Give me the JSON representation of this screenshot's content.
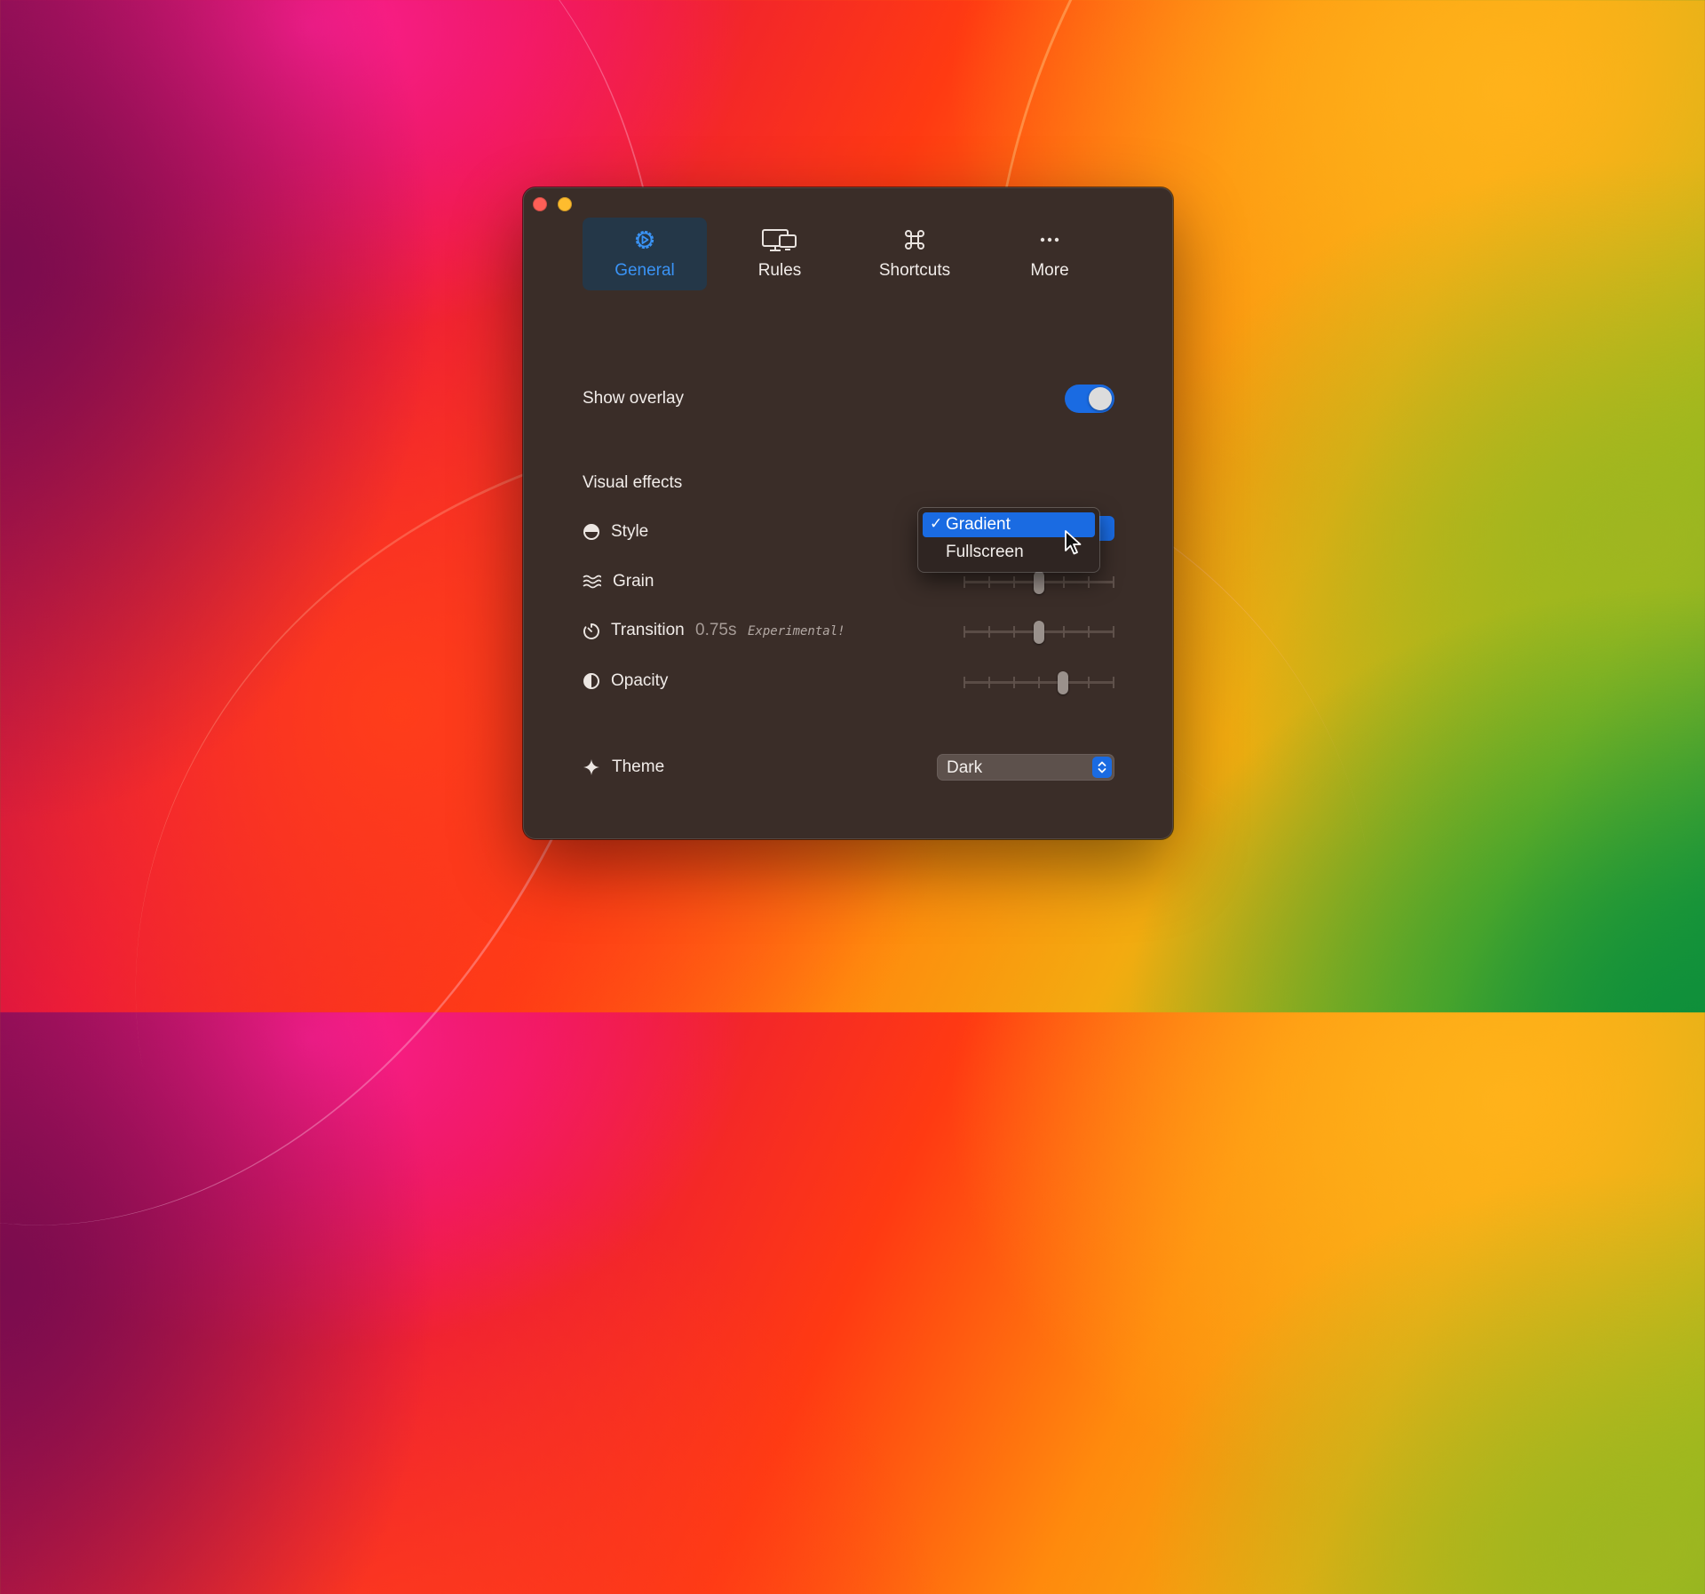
{
  "tabs": [
    {
      "label": "General",
      "icon": "gear-icon",
      "active": true
    },
    {
      "label": "Rules",
      "icon": "displays-icon",
      "active": false
    },
    {
      "label": "Shortcuts",
      "icon": "command-icon",
      "active": false
    },
    {
      "label": "More",
      "icon": "ellipsis-icon",
      "active": false
    }
  ],
  "show_overlay": {
    "label": "Show overlay",
    "enabled": true
  },
  "visual_effects": {
    "heading": "Visual effects",
    "style": {
      "label": "Style",
      "icon": "half-circle-icon",
      "options": [
        "Gradient",
        "Fullscreen"
      ],
      "selected": "Gradient",
      "check_mark": "✓"
    },
    "grain": {
      "label": "Grain",
      "icon": "waves-icon",
      "level": 0.5
    },
    "transition": {
      "label": "Transition",
      "icon": "timer-icon",
      "value": "0.75s",
      "note": "Experimental!",
      "level": 0.5
    },
    "opacity": {
      "label": "Opacity",
      "icon": "contrast-icon",
      "level": 0.66
    }
  },
  "theme": {
    "label": "Theme",
    "icon": "sparkle-icon",
    "value": "Dark"
  },
  "colors": {
    "accent": "#1a6be2",
    "active_tab_text": "#3a93f5",
    "window_bg": "#3a2d28",
    "close": "#fe5f57",
    "minimize": "#febc2e"
  }
}
